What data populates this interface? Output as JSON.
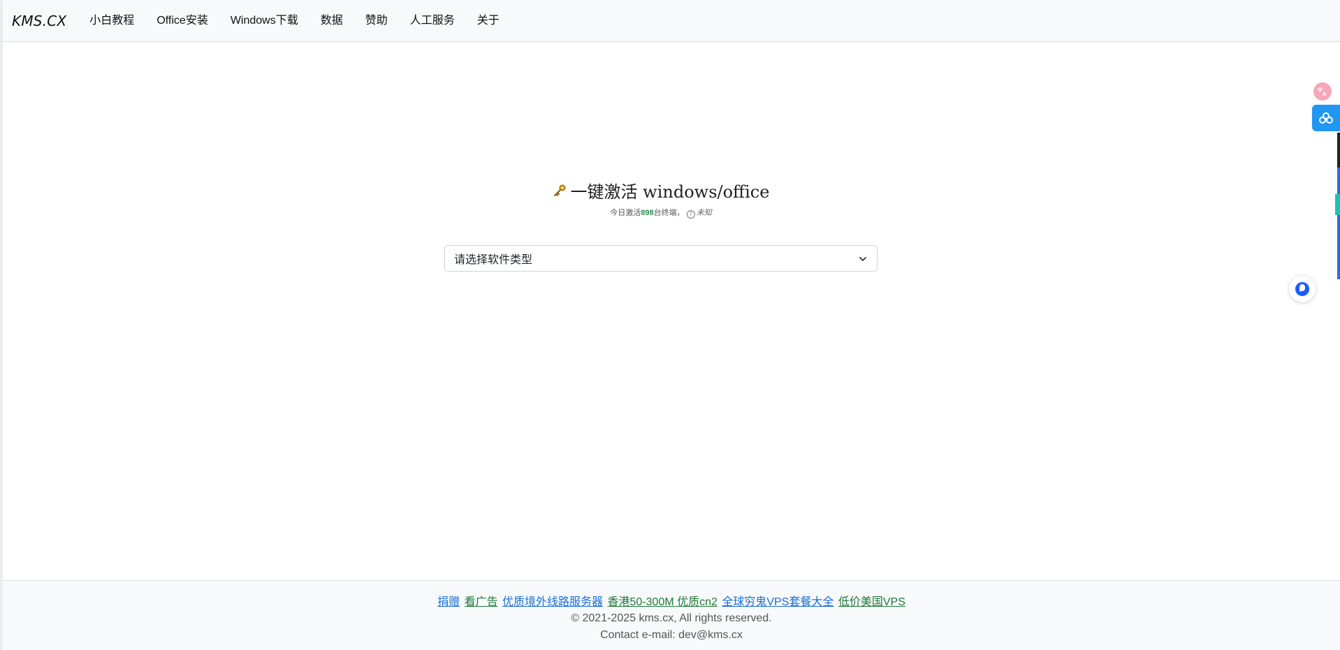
{
  "navbar": {
    "brand": "KMS.CX",
    "items": [
      {
        "label": "小白教程"
      },
      {
        "label": "Office安装"
      },
      {
        "label": "Windows下载"
      },
      {
        "label": "数据"
      },
      {
        "label": "赞助"
      },
      {
        "label": "人工服务"
      },
      {
        "label": "关于"
      }
    ]
  },
  "hero": {
    "icon": "key-icon",
    "title": "一键激活 windows/office",
    "sub_prefix": "今日激活",
    "sub_count": "898",
    "sub_suffix": "台终端，",
    "sub_status": "未知"
  },
  "select": {
    "value": "请选择软件类型"
  },
  "floating": {
    "translate_icon": "translate-icon",
    "baidu_icon": "baidu-cloud-icon",
    "chat_icon": "chat-icon"
  },
  "footer": {
    "links": [
      {
        "label": "捐赠",
        "color": "#1a6fd6"
      },
      {
        "label": "看广告",
        "color": "#1f7a3a"
      },
      {
        "label": "优质境外线路服务器",
        "color": "#1a6fd6"
      },
      {
        "label": "香港50-300M 优质cn2",
        "color": "#1f7a3a"
      },
      {
        "label": "全球穷鬼VPS套餐大全",
        "color": "#1a6fd6"
      },
      {
        "label": "低价美国VPS",
        "color": "#1f7a3a"
      }
    ],
    "copyright": "© 2021-2025 kms.cx, All rights reserved.",
    "contact": "Contact e-mail: dev@kms.cx"
  }
}
